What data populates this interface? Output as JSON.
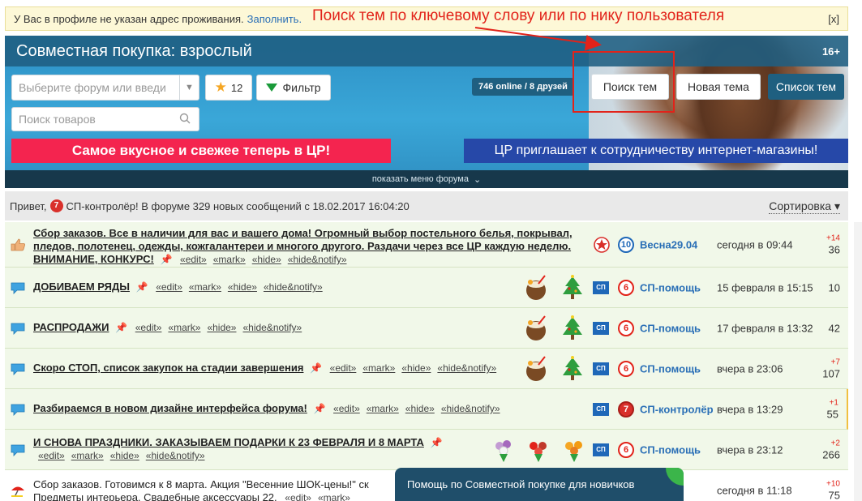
{
  "notice": {
    "text": "У Вас в профиле не указан адрес проживания.",
    "link": "Заполнить.",
    "close": "[x]"
  },
  "annotation": "Поиск тем по ключевому слову или по нику пользователя",
  "header": {
    "title": "Совместная покупка: взрослый",
    "age": "16+",
    "forum_select_placeholder": "Выберите форум или введи",
    "fav_count": "12",
    "filter_label": "Фильтр",
    "search_goods_placeholder": "Поиск товаров",
    "online": "746 online / 8 друзей",
    "btn_search_topics": "Поиск тем",
    "btn_new_topic": "Новая тема",
    "btn_topic_list": "Список тем",
    "banner_left": "Самое вкусное и свежее теперь в ЦР!",
    "banner_right": "ЦР приглашает к сотрудничеству интернет-магазины!",
    "menu_toggle": "показать меню форума"
  },
  "greeting": {
    "hello": "Привет,",
    "user": "СП-контролёр! В форуме 329 новых сообщений с 18.02.2017 16:04:20",
    "sort": "Сортировка",
    "badge": "7"
  },
  "tools": {
    "edit": "«edit»",
    "mark": "«mark»",
    "hide": "«hide»",
    "hidenotify": "«hide&notify»"
  },
  "sp_badge": "СП",
  "topics": [
    {
      "title": "Сбор заказов. Все в наличии для вас и вашего дома! Огромный выбор постельного белья, покрывал, пледов, полотенец, одежды, кожгалантереи и многого другого. Раздачи через все ЦР каждую неделю. ВНИМАНИЕ, КОНКУРС!",
      "author": "Весна29.04",
      "date": "сегодня в 09:44",
      "plus": "+14",
      "count": "36",
      "badge": "10"
    },
    {
      "title": "ДОБИВАЕМ РЯДЫ",
      "author": "СП-помощь",
      "date": "15 февраля в 15:15",
      "plus": "",
      "count": "10",
      "badge": "6"
    },
    {
      "title": "РАСПРОДАЖИ",
      "author": "СП-помощь",
      "date": "17 февраля в 13:32",
      "plus": "",
      "count": "42",
      "badge": "6"
    },
    {
      "title": "Скоро СТОП, список закупок на стадии завершения",
      "author": "СП-помощь",
      "date": "вчера в 23:06",
      "plus": "+7",
      "count": "107",
      "badge": "6"
    },
    {
      "title": "Разбираемся в новом дизайне интерфейса форума!",
      "author": "СП-контролёр",
      "date": "вчера в 13:29",
      "plus": "+1",
      "count": "55",
      "badge": "7"
    },
    {
      "title": "И СНОВА ПРАЗДНИКИ. ЗАКАЗЫВАЕМ ПОДАРКИ К 23 ФЕВРАЛЯ И 8 МАРТА",
      "author": "СП-помощь",
      "date": "вчера в 23:12",
      "plus": "+2",
      "count": "266",
      "badge": "6"
    },
    {
      "title": "Сбор заказов. Готовимся к 8 марта. Акция \"Весенние ШОК-цены!\" ск Предметы интерьера. Свадебные аксессуары 22.",
      "author": "",
      "date": "сегодня в 11:18",
      "plus": "+10",
      "count": "75",
      "badge": ""
    }
  ],
  "help": "Помощь по Совместной покупке для новичков",
  "colors": {
    "accent_red": "#e2231a",
    "link_blue": "#2a6fb6",
    "header_blue": "#2d8fc4",
    "row_green": "#f1f8e9"
  }
}
